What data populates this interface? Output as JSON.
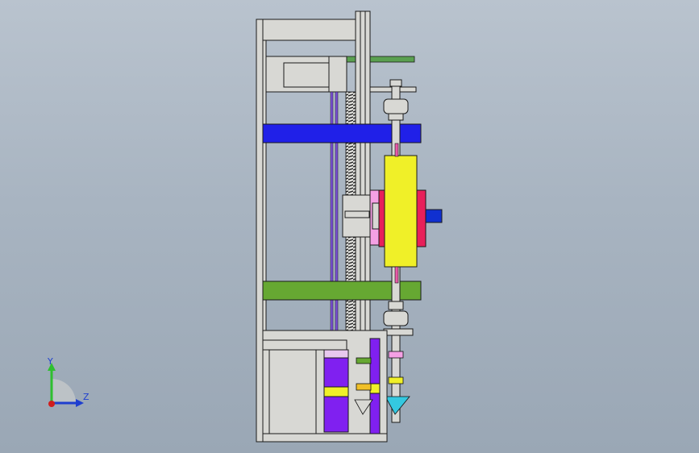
{
  "view": {
    "type": "CAD orthographic side view",
    "background_color": "#a8b4c1"
  },
  "axes": {
    "y_label": "Y",
    "z_label": "Z",
    "y_color": "#2fbf2f",
    "z_color": "#1f3fcf",
    "x_color": "#d01e1e"
  },
  "parts": {
    "frame": {
      "color": "#d8d8d4",
      "edge_color": "#1a1a1a"
    },
    "upper_crossbar": {
      "color": "#2020e8"
    },
    "lower_crossbar": {
      "color": "#66a832"
    },
    "roller": {
      "color": "#f0f028"
    },
    "carriage_block": {
      "color": "#e8205a"
    },
    "carriage_inner": {
      "color": "#f4a0e4"
    },
    "shaft_end": {
      "color": "#1030d0"
    },
    "top_plate": {
      "color": "#5aa050"
    },
    "lower_box_fill": {
      "color": "#8020f0"
    },
    "lower_box_band": {
      "color": "#f0f028"
    },
    "lower_box_top": {
      "color": "#e8c8ee"
    },
    "thin_rod": {
      "color": "#7a50d8"
    }
  }
}
